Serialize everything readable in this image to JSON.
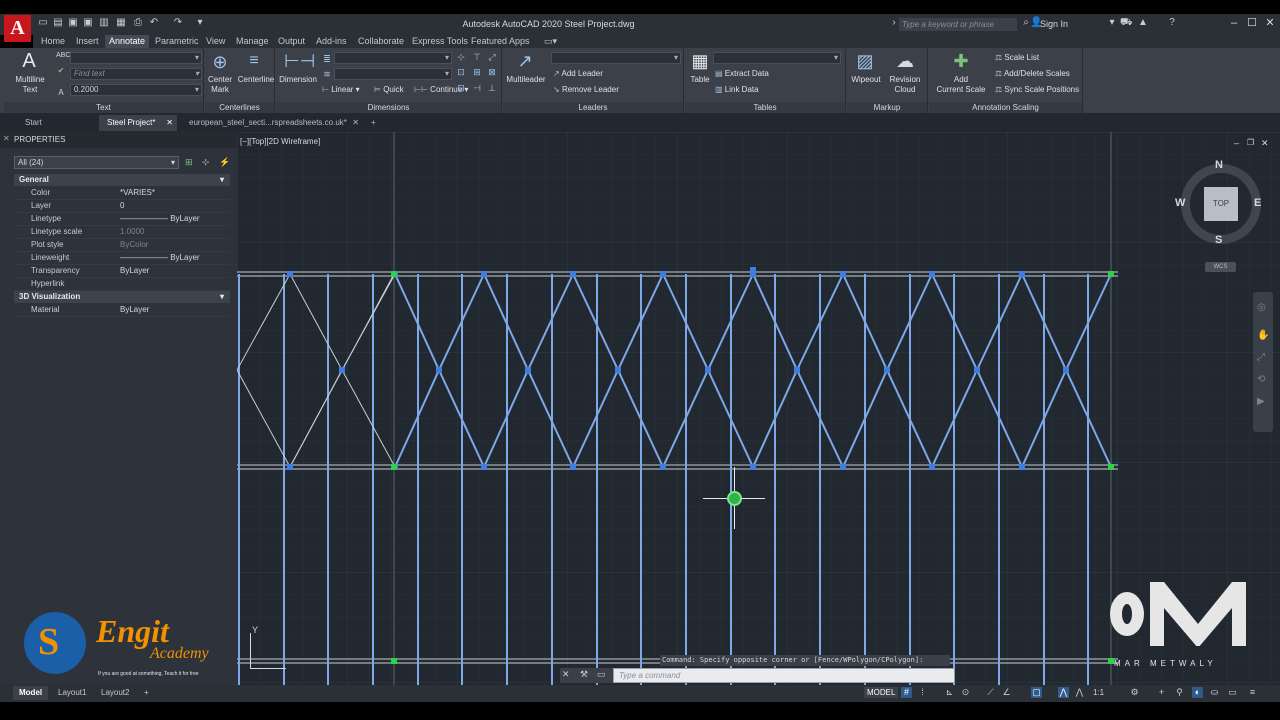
{
  "app": {
    "title": "Autodesk AutoCAD 2020    Steel Project.dwg",
    "logo": "A",
    "search_placeholder": "Type a keyword or phrase",
    "sign_in": "Sign In"
  },
  "ribbon_tabs": [
    "Home",
    "Insert",
    "Annotate",
    "Parametric",
    "View",
    "Manage",
    "Output",
    "Add-ins",
    "Collaborate",
    "Express Tools",
    "Featured Apps"
  ],
  "ribbon_active": "Annotate",
  "panels": {
    "text": {
      "title": "Text",
      "multiline": "Multiline\nText",
      "find_placeholder": "Find text",
      "height": "0.2000"
    },
    "centerlines": {
      "title": "Centerlines",
      "center_mark": "Center\nMark",
      "centerline": "Centerline"
    },
    "dimensions": {
      "title": "Dimensions",
      "dimension": "Dimension",
      "linear": "Linear",
      "quick": "Quick",
      "continue": "Continue"
    },
    "leaders": {
      "title": "Leaders",
      "multileader": "Multileader",
      "add_leader": "Add Leader",
      "remove_leader": "Remove Leader"
    },
    "tables": {
      "title": "Tables",
      "table": "Table",
      "extract": "Extract Data",
      "link": "Link Data"
    },
    "markup": {
      "title": "Markup",
      "wipeout": "Wipeout",
      "revision": "Revision\nCloud"
    },
    "scaling": {
      "title": "Annotation Scaling",
      "add_scale": "Add\nCurrent Scale",
      "scale_list": "Scale List",
      "add_delete": "Add/Delete Scales",
      "sync": "Sync Scale Positions"
    }
  },
  "file_tabs": [
    "Start",
    "Steel Project*",
    "european_steel_secti...rspreadsheets.co.uk*"
  ],
  "file_tab_active": "Steel Project*",
  "properties": {
    "header": "PROPERTIES",
    "selection": "All (24)",
    "general_label": "General",
    "visualization_label": "3D Visualization",
    "general": [
      {
        "name": "Color",
        "value": "*VARIES*",
        "dim": false
      },
      {
        "name": "Layer",
        "value": "0",
        "dim": false
      },
      {
        "name": "Linetype",
        "value": "——————  ByLayer",
        "dim": false
      },
      {
        "name": "Linetype scale",
        "value": "1.0000",
        "dim": true
      },
      {
        "name": "Plot style",
        "value": "ByColor",
        "dim": true
      },
      {
        "name": "Lineweight",
        "value": "——————  ByLayer",
        "dim": false
      },
      {
        "name": "Transparency",
        "value": "ByLayer",
        "dim": false
      },
      {
        "name": "Hyperlink",
        "value": "",
        "dim": false
      }
    ],
    "visualization": [
      {
        "name": "Material",
        "value": "ByLayer",
        "dim": false
      }
    ]
  },
  "viewport": {
    "label": "[−][Top][2D Wireframe]",
    "viewcube": {
      "top": "TOP",
      "n": "N",
      "s": "S",
      "e": "E",
      "w": "W",
      "wcs": "WCS"
    },
    "ucs_y": "Y"
  },
  "command": {
    "history": "Command: Specify opposite corner or [Fence/WPolygon/CPolygon]:",
    "placeholder": "Type a command"
  },
  "layout_tabs": [
    "Model",
    "Layout1",
    "Layout2"
  ],
  "layout_active": "Model",
  "status": {
    "model": "MODEL",
    "scale": "1:1"
  },
  "watermarks": {
    "left_brand": "Engit",
    "left_sub": "Academy",
    "left_tagline": "If you are good at something, Teach it for free",
    "right_brand": "MAR METWALY"
  }
}
